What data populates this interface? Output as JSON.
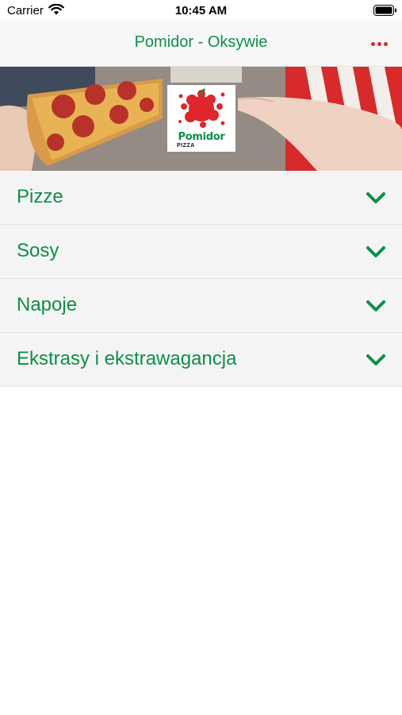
{
  "status_bar": {
    "carrier": "Carrier",
    "time": "10:45 AM"
  },
  "nav": {
    "title": "Pomidor - Oksywie",
    "more_icon": "ellipsis-icon"
  },
  "hero": {
    "logo": {
      "brand": "Pomidor",
      "sub": "PIZZA"
    }
  },
  "menu": {
    "items": [
      {
        "label": "Pizze"
      },
      {
        "label": "Sosy"
      },
      {
        "label": "Napoje"
      },
      {
        "label": "Ekstrasy i ekstrawagancja"
      }
    ]
  },
  "colors": {
    "accent": "#0d8f4a",
    "more_dots": "#e0262b",
    "row_background": "#f4f4f4",
    "nav_background": "#f7f7f7"
  }
}
